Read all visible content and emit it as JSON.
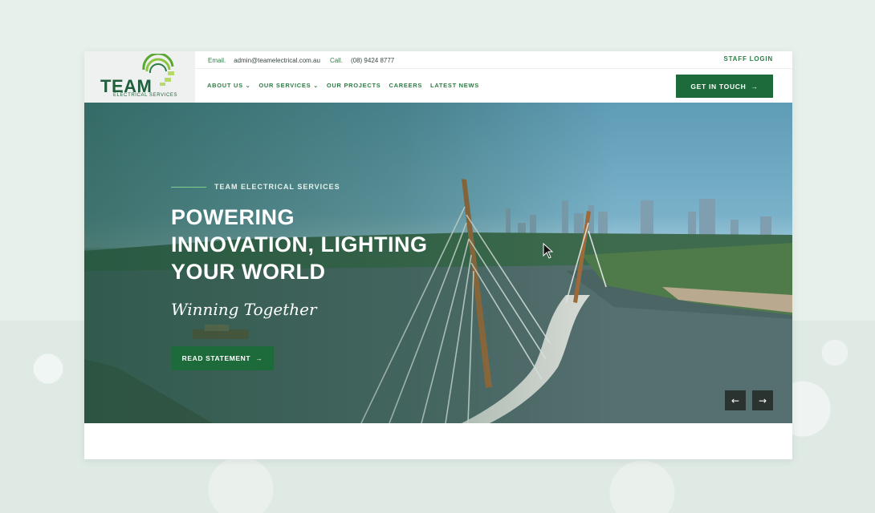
{
  "brand": {
    "logo_word": "TEAM",
    "logo_sub": "ELECTRICAL SERVICES",
    "green": "#1d6b3a",
    "accent": "#2d7d46"
  },
  "topbar": {
    "email_label": "Email.",
    "email": "admin@teamelectrical.com.au",
    "call_label": "Call.",
    "phone": "(08) 9424 8777",
    "staff_login": "STAFF LOGIN"
  },
  "nav": {
    "items": [
      {
        "label": "ABOUT US",
        "dropdown": true
      },
      {
        "label": "OUR SERVICES",
        "dropdown": true
      },
      {
        "label": "OUR PROJECTS",
        "dropdown": false
      },
      {
        "label": "CAREERS",
        "dropdown": false
      },
      {
        "label": "LATEST NEWS",
        "dropdown": false
      }
    ],
    "cta": "GET IN TOUCH"
  },
  "hero": {
    "eyebrow": "TEAM ELECTRICAL SERVICES",
    "headline_lines": [
      "POWERING",
      "INNOVATION, LIGHTING",
      "YOUR WORLD"
    ],
    "script_text": "Winning Together",
    "button": "READ STATEMENT",
    "icons": {
      "arrow": "arrow-right-icon",
      "prev": "arrow-left-icon",
      "next": "arrow-right-icon"
    }
  }
}
